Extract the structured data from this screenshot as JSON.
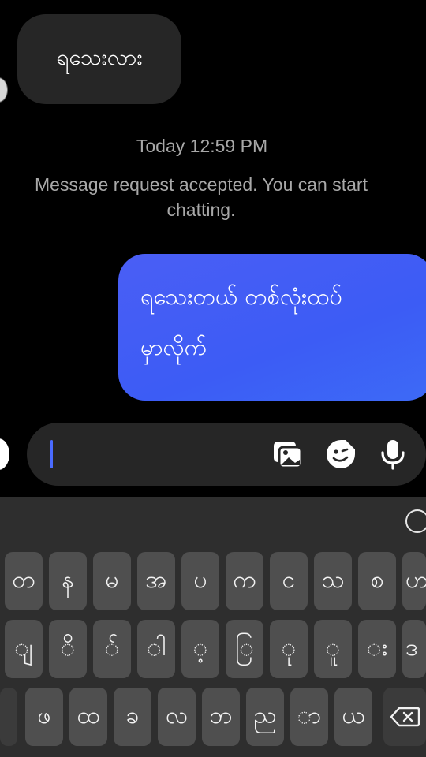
{
  "chat": {
    "incoming_message": "ရသေးလား",
    "timestamp": "Today 12:59 PM",
    "notice": "Message request accepted. You can start chatting.",
    "outgoing_message_line1": "ရသေးတယ် တစ်လုံးထပ်",
    "outgoing_message_line2": "မှာလိုက်"
  },
  "composer": {
    "value": "",
    "icons": [
      "camera-icon",
      "gallery-icon",
      "sticker-icon",
      "microphone-icon"
    ]
  },
  "keyboard": {
    "row1": [
      "တ",
      "န",
      "မ",
      "အ",
      "ပ",
      "က",
      "င",
      "သ",
      "စ",
      "ဟ"
    ],
    "row2": [
      "ျ",
      "ိ",
      "်",
      "ါ",
      "့",
      "ြ",
      "ု",
      "ူ",
      "း",
      "ဒ"
    ],
    "row3": [
      "ဖ",
      "ထ",
      "ခ",
      "လ",
      "ဘ",
      "ည",
      "ာ",
      "ယ"
    ],
    "icons": [
      "emoji-icon",
      "shift-icon",
      "backspace-icon"
    ]
  },
  "colors": {
    "background": "#000000",
    "incoming_bubble": "#262626",
    "outgoing_bubble": "#4a5ef5",
    "meta_text": "#a8a8a8",
    "keyboard": "#2e2e2e",
    "key": "#4f4f4f"
  }
}
